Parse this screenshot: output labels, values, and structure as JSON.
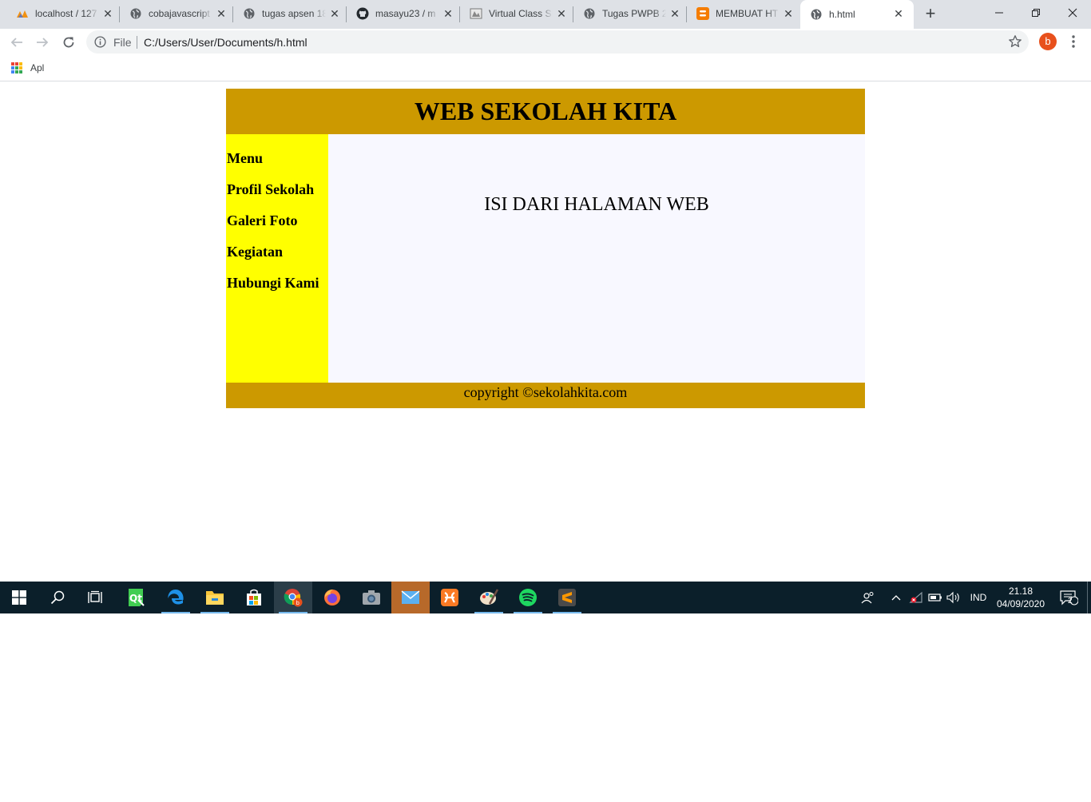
{
  "browser": {
    "tabs": [
      {
        "label": "localhost / 127",
        "icon": "phpmyadmin-icon"
      },
      {
        "label": "cobajavascript",
        "icon": "globe-icon"
      },
      {
        "label": "tugas apsen 18",
        "icon": "globe-icon"
      },
      {
        "label": "masayu23 / m",
        "icon": "github-icon"
      },
      {
        "label": "Virtual Class SI",
        "icon": "virtual-class-icon"
      },
      {
        "label": "Tugas PWPB 2",
        "icon": "globe-icon"
      },
      {
        "label": "MEMBUAT HT",
        "icon": "blogger-icon"
      },
      {
        "label": "h.html",
        "icon": "globe-icon",
        "active": true
      }
    ],
    "omnibox": {
      "scheme": "File",
      "url": "C:/Users/User/Documents/h.html"
    },
    "profile_initial": "b",
    "bookmarks": {
      "apps_label": "Apl"
    }
  },
  "site": {
    "header_title": "WEB SEKOLAH KITA",
    "menu": [
      "Menu",
      "Profil Sekolah",
      "Galeri Foto",
      "Kegiatan",
      "Hubungi Kami"
    ],
    "content_text": "ISI DARI HALAMAN WEB",
    "footer_text": "copyright ©sekolahkita.com",
    "colors": {
      "header": "#cc9900",
      "sidebar": "#ffff00",
      "main": "#f8f8ff",
      "footer": "#cc9900"
    }
  },
  "taskbar": {
    "apps": [
      "start-icon",
      "search-icon",
      "task-view-icon",
      "qt-creator-icon",
      "edge-icon",
      "file-explorer-icon",
      "store-icon",
      "chrome-icon",
      "firefox-icon",
      "camera-icon",
      "mail-icon",
      "xampp-icon",
      "paint-icon",
      "spotify-icon",
      "sublime-text-icon"
    ],
    "language": "IND",
    "time": "21.18",
    "date": "04/09/2020",
    "notification_count": "2"
  }
}
